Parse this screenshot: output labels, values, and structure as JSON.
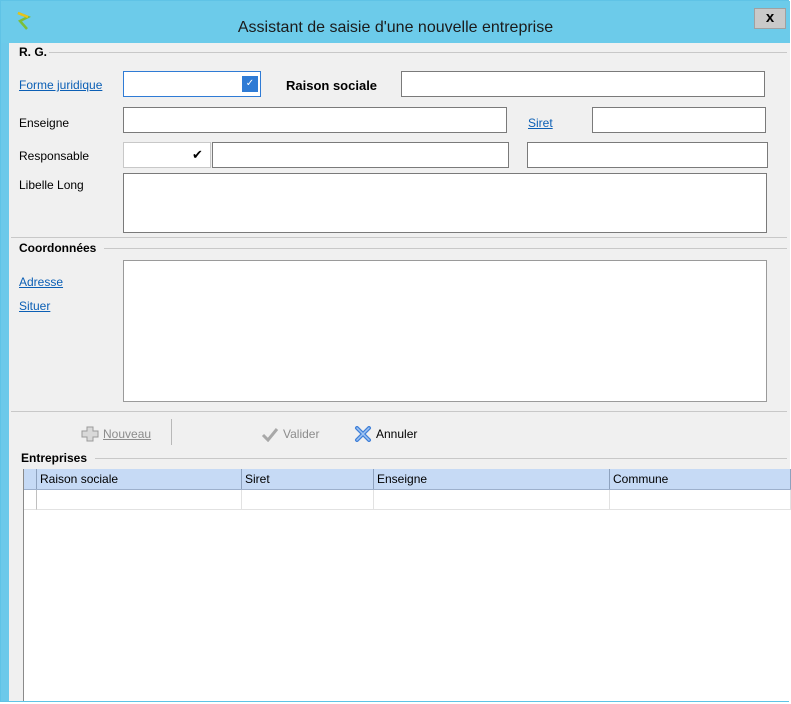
{
  "window": {
    "title": "Assistant de saisie d'une nouvelle entreprise",
    "close_label": "x"
  },
  "rg": {
    "group_title": "R. G.",
    "forme_juridique_label": "Forme juridique",
    "forme_juridique_value": "",
    "raison_sociale_label": "Raison sociale",
    "raison_sociale_value": "",
    "enseigne_label": "Enseigne",
    "enseigne_value": "",
    "siret_label": "Siret",
    "siret_value": "",
    "responsable_label": "Responsable",
    "responsable_civilite": "",
    "responsable_nom": "",
    "responsable_prenom": "",
    "libelle_long_label": "Libelle Long",
    "libelle_long_value": ""
  },
  "coordonnees": {
    "group_title": "Coordonnées",
    "adresse_link": "Adresse",
    "situer_link": "Situer",
    "address_value": ""
  },
  "toolbar": {
    "nouveau_label": "Nouveau",
    "valider_label": "Valider",
    "annuler_label": "Annuler"
  },
  "entreprises": {
    "group_title": "Entreprises",
    "columns": [
      "Raison sociale",
      "Siret",
      "Enseigne",
      "Commune"
    ]
  },
  "colors": {
    "title_bar": "#6ccbea",
    "link": "#0b5fb5",
    "grid_header": "#c6daf5",
    "combo_arrow": "#2f7bd5"
  }
}
